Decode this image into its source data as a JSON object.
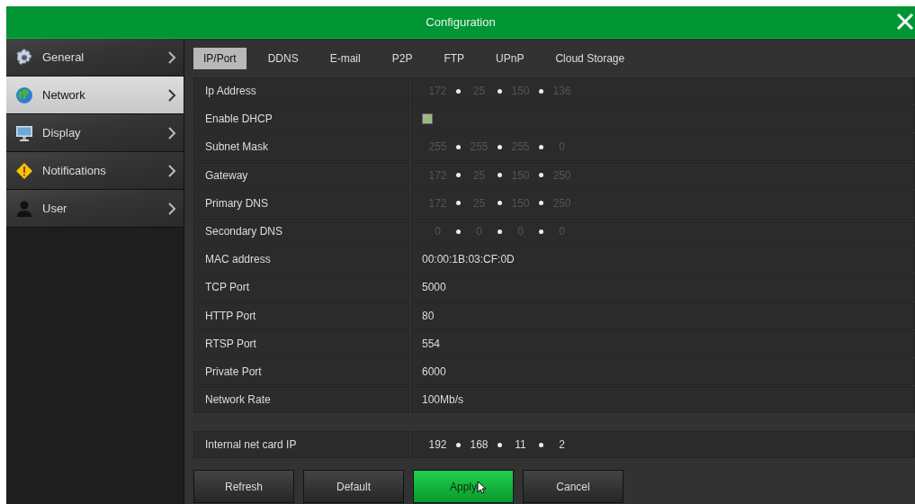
{
  "window": {
    "title": "Configuration"
  },
  "sidebar": {
    "items": [
      {
        "label": "General",
        "selected": false
      },
      {
        "label": "Network",
        "selected": true
      },
      {
        "label": "Display",
        "selected": false
      },
      {
        "label": "Notifications",
        "selected": false
      },
      {
        "label": "User",
        "selected": false
      }
    ]
  },
  "tabs": [
    {
      "label": "IP/Port",
      "selected": true
    },
    {
      "label": "DDNS",
      "selected": false
    },
    {
      "label": "E-mail",
      "selected": false
    },
    {
      "label": "P2P",
      "selected": false
    },
    {
      "label": "FTP",
      "selected": false
    },
    {
      "label": "UPnP",
      "selected": false
    },
    {
      "label": "Cloud Storage",
      "selected": false
    }
  ],
  "settings": [
    {
      "label": "Ip Address",
      "kind": "ip",
      "disabled": true,
      "segments": [
        "172",
        "25",
        "150",
        "136"
      ]
    },
    {
      "label": "Enable DHCP",
      "kind": "checkbox",
      "checked": true
    },
    {
      "label": "Subnet Mask",
      "kind": "ip",
      "disabled": true,
      "segments": [
        "255",
        "255",
        "255",
        "0"
      ]
    },
    {
      "label": "Gateway",
      "kind": "ip",
      "disabled": true,
      "segments": [
        "172",
        "25",
        "150",
        "250"
      ]
    },
    {
      "label": "Primary DNS",
      "kind": "ip",
      "disabled": true,
      "segments": [
        "172",
        "25",
        "150",
        "250"
      ]
    },
    {
      "label": "Secondary DNS",
      "kind": "ip",
      "disabled": true,
      "segments": [
        "0",
        "0",
        "0",
        "0"
      ]
    },
    {
      "label": "MAC address",
      "kind": "text",
      "value": "00:00:1B:03:CF:0D"
    },
    {
      "label": "TCP Port",
      "kind": "text",
      "value": "5000"
    },
    {
      "label": "HTTP Port",
      "kind": "text",
      "value": "80"
    },
    {
      "label": "RTSP Port",
      "kind": "text",
      "value": "554"
    },
    {
      "label": "Private Port",
      "kind": "text",
      "value": "6000"
    },
    {
      "label": "Network Rate",
      "kind": "text",
      "value": "100Mb/s"
    }
  ],
  "internal": [
    {
      "label": "Internal net card IP",
      "kind": "ip",
      "disabled": false,
      "segments": [
        "192",
        "168",
        "11",
        "2"
      ]
    }
  ],
  "buttons": [
    {
      "label": "Refresh",
      "primary": false,
      "hovered": false
    },
    {
      "label": "Default",
      "primary": false,
      "hovered": false
    },
    {
      "label": "Apply",
      "primary": true,
      "hovered": true
    },
    {
      "label": "Cancel",
      "primary": false,
      "hovered": false
    }
  ]
}
